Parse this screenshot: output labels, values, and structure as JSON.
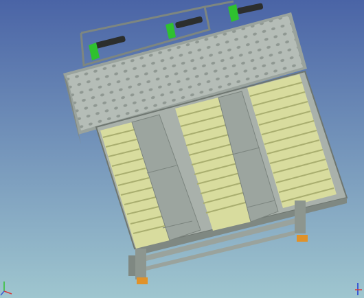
{
  "viewport": {
    "background_top": "#4a64a6",
    "background_bottom": "#9fc6cf",
    "frame_color": "#9ea8a2",
    "frame_dark": "#6e7670",
    "perforated_plate": "#b5bdb7",
    "roller_color": "#d8dc9e",
    "roller_stripe": "#a9ae6f",
    "actuator_green": "#2fc12f",
    "cylinder_dark": "#2c2e2d",
    "foot_orange": "#e0922a"
  },
  "icons": {
    "axis_triad": "axis-triad-icon",
    "view_cube": "view-orientation-icon"
  }
}
